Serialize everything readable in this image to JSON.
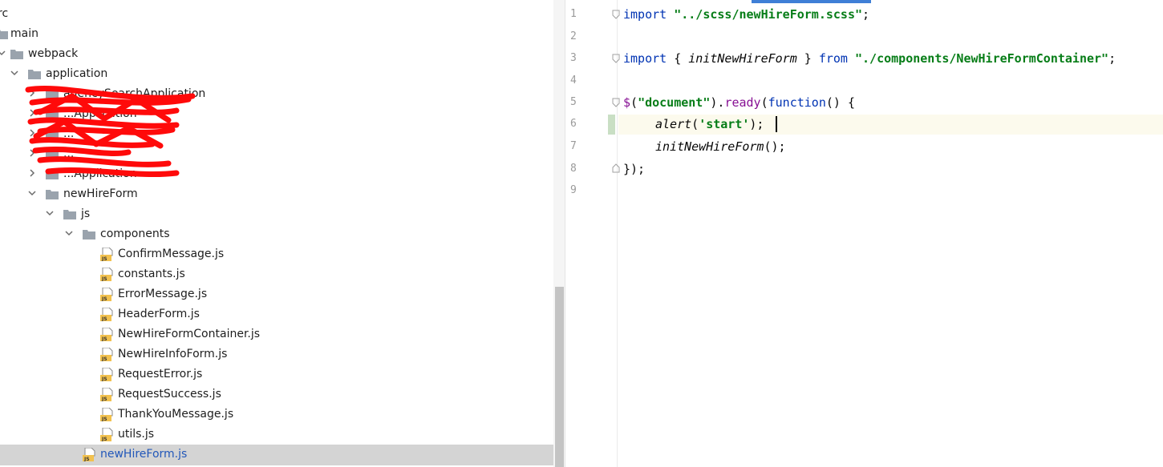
{
  "tree": {
    "items": [
      {
        "label": "rc",
        "type": "folder-partial"
      },
      {
        "label": "main",
        "type": "folder"
      },
      {
        "label": "webpack",
        "type": "folder"
      },
      {
        "label": "application",
        "type": "folder"
      },
      {
        "label": "agencySearchApplication",
        "type": "folder"
      },
      {
        "label": "...Application",
        "type": "folder"
      },
      {
        "label": "...",
        "type": "folder"
      },
      {
        "label": "...",
        "type": "folder"
      },
      {
        "label": "...Application",
        "type": "folder"
      },
      {
        "label": "newHireForm",
        "type": "folder"
      },
      {
        "label": "js",
        "type": "folder"
      },
      {
        "label": "components",
        "type": "folder"
      },
      {
        "label": "ConfirmMessage.js",
        "type": "js"
      },
      {
        "label": "constants.js",
        "type": "js"
      },
      {
        "label": "ErrorMessage.js",
        "type": "js"
      },
      {
        "label": "HeaderForm.js",
        "type": "js"
      },
      {
        "label": "NewHireFormContainer.js",
        "type": "js"
      },
      {
        "label": "NewHireInfoForm.js",
        "type": "js"
      },
      {
        "label": "RequestError.js",
        "type": "js"
      },
      {
        "label": "RequestSuccess.js",
        "type": "js"
      },
      {
        "label": "ThankYouMessage.js",
        "type": "js"
      },
      {
        "label": "utils.js",
        "type": "js"
      },
      {
        "label": "newHireForm.js",
        "type": "js",
        "selected": true
      }
    ],
    "js_badge": "JS"
  },
  "editor": {
    "line_numbers": [
      "1",
      "2",
      "3",
      "4",
      "5",
      "6",
      "7",
      "8",
      "9"
    ],
    "code": {
      "l1_kw": "import",
      "l1_str": "\"../scss/newHireForm.scss\"",
      "l1_end": ";",
      "l3_kw": "import",
      "l3_a": " { ",
      "l3_name": "initNewHireForm",
      "l3_b": " } ",
      "l3_from": "from",
      "l3_str": "\"./components/NewHireFormContainer\"",
      "l3_end": ";",
      "l5_dollar": "$",
      "l5_a": "(",
      "l5_str": "\"document\"",
      "l5_b": ").",
      "l5_ready": "ready",
      "l5_c": "(",
      "l5_fn": "function",
      "l5_d": "() {",
      "l6_call": "alert",
      "l6_a": "(",
      "l6_str": "'start'",
      "l6_b": ");",
      "l7_call": "initNewHireForm",
      "l7_a": "();",
      "l8": "});"
    }
  },
  "colors": {
    "keyword": "#0033b3",
    "string": "#067d17",
    "selection": "#d4d4d4",
    "accent": "#3f7fd6"
  }
}
